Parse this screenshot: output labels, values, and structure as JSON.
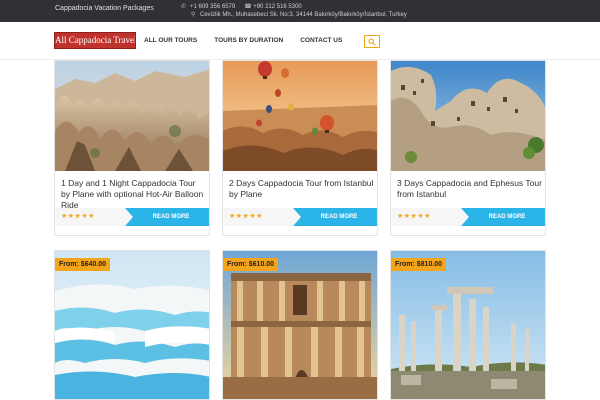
{
  "topbar": {
    "brand": "Cappadocia Vacation Packages",
    "phone1": "+1 609 356 6579",
    "phone2": "+90 212 516 5300",
    "address": "Cevizlik Mh., Muhasebeci Sk. No:3, 34144 Bakırköy/Bakırköy/İstanbul, Turkey"
  },
  "header": {
    "logo": "All Cappadocia Travel",
    "nav": [
      "ALL OUR TOURS",
      "TOURS BY DURATION",
      "CONTACT US"
    ]
  },
  "tours": [
    {
      "title": "1 Day and 1 Night Cappadocia Tour by Plane with optional Hot-Air Balloon Ride",
      "stars": "★★★★★",
      "button": "READ MORE",
      "image": "fairy-chimneys"
    },
    {
      "title": "2 Days Cappadocia Tour from Istanbul by Plane",
      "stars": "★★★★★",
      "button": "READ MORE",
      "image": "hot-air-balloons"
    },
    {
      "title": "3 Days Cappadocia and Ephesus Tour from Istanbul",
      "stars": "★★★★★",
      "button": "READ MORE",
      "image": "cave-dwellings"
    }
  ],
  "tours_bottom": [
    {
      "price": "From: $640.00",
      "image": "pamukkale-travertines"
    },
    {
      "price": "From: $610.00",
      "image": "library-of-celsus"
    },
    {
      "price": "From: $810.00",
      "image": "ancient-columns"
    }
  ],
  "colors": {
    "accent": "#2bb4e8",
    "price": "#f5a51c",
    "topbar": "#2f3136",
    "logo": "#c0322c"
  }
}
